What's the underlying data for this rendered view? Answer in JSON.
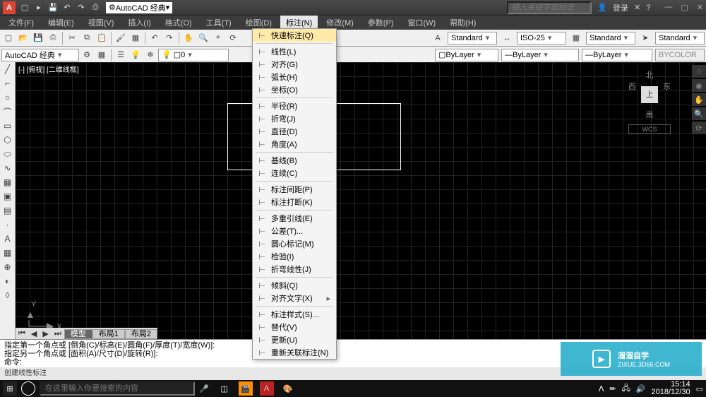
{
  "titlebar": {
    "workspace_label": "AutoCAD 经典",
    "search_placeholder": "键入关键字或短语",
    "login": "登录"
  },
  "menubar": {
    "items": [
      "文件(F)",
      "编辑(E)",
      "视图(V)",
      "插入(I)",
      "格式(O)",
      "工具(T)",
      "绘图(D)",
      "标注(N)",
      "修改(M)",
      "参数(P)",
      "窗口(W)",
      "帮助(H)"
    ],
    "active_index": 7
  },
  "tool_row1": {
    "combos": [
      {
        "label": "Standard"
      },
      {
        "label": "ISO-25"
      },
      {
        "label": "Standard"
      },
      {
        "label": "Standard"
      }
    ]
  },
  "tool_row2": {
    "ws_combo": "AutoCAD 经典",
    "layer_state": "0",
    "bylayer1": "ByLayer",
    "bylayer2": "ByLayer",
    "bylayer3": "ByLayer",
    "bycolor": "BYCOLOR"
  },
  "dropdown": {
    "items": [
      {
        "label": "快速标注(Q)",
        "hl": true
      },
      {
        "sep": true
      },
      {
        "label": "线性(L)"
      },
      {
        "label": "对齐(G)"
      },
      {
        "label": "弧长(H)"
      },
      {
        "label": "坐标(O)"
      },
      {
        "sep": true
      },
      {
        "label": "半径(R)"
      },
      {
        "label": "折弯(J)"
      },
      {
        "label": "直径(D)"
      },
      {
        "label": "角度(A)"
      },
      {
        "sep": true
      },
      {
        "label": "基线(B)"
      },
      {
        "label": "连续(C)"
      },
      {
        "sep": true
      },
      {
        "label": "标注间距(P)"
      },
      {
        "label": "标注打断(K)"
      },
      {
        "sep": true
      },
      {
        "label": "多重引线(E)"
      },
      {
        "label": "公差(T)..."
      },
      {
        "label": "圆心标记(M)"
      },
      {
        "label": "检验(I)"
      },
      {
        "label": "折弯线性(J)"
      },
      {
        "sep": true
      },
      {
        "label": "倾斜(Q)"
      },
      {
        "label": "对齐文字(X)",
        "sub": true
      },
      {
        "sep": true
      },
      {
        "label": "标注样式(S)..."
      },
      {
        "label": "替代(V)"
      },
      {
        "label": "更新(U)"
      },
      {
        "label": "重新关联标注(N)"
      }
    ]
  },
  "canvas": {
    "tab_title": "[-] [俯视] [二维线框]",
    "viewcube": {
      "n": "北",
      "s": "南",
      "e": "东",
      "w": "西",
      "top": "上",
      "wcs": "WCS"
    },
    "ucs_y": "Y",
    "ucs_x": "X"
  },
  "model_tabs": {
    "items": [
      "模型",
      "布局1",
      "布局2"
    ],
    "active": 0
  },
  "cmd": {
    "line1": "指定第一个角点或 [倒角(C)/标高(E)/圆角(F)/厚度(T)/宽度(W)]:",
    "line2": "指定另一个角点或 [面积(A)/尺寸(D)/旋转(R)]:",
    "line3": "命令:"
  },
  "status": {
    "text": "创建线性标注"
  },
  "taskbar": {
    "search_placeholder": "在这里输入你要搜索的内容",
    "time": "15:14",
    "date": "2018/12/30"
  },
  "watermark": {
    "name": "溜溜自学",
    "url": "ZIXUE.3D66.COM"
  }
}
